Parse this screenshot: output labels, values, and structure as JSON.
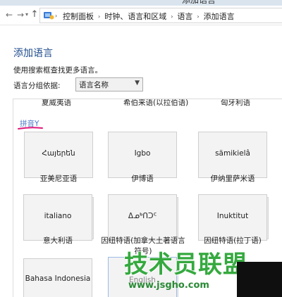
{
  "window": {
    "title": "添加语言"
  },
  "address": {
    "crumbs": [
      "控制面板",
      "时钟、语言和区域",
      "语言",
      "添加语言"
    ]
  },
  "page": {
    "title": "添加语言",
    "hint": "使用搜索框查找更多语言。",
    "group_label": "语言分组依据:",
    "group_value": "语言名称"
  },
  "previous_row": [
    "夏威夷语",
    "希伯来语(以拉伯语)",
    "匈牙利语"
  ],
  "section": {
    "header": "拼音Y"
  },
  "tiles": [
    {
      "native": "Հայերեն",
      "caption": "亚美尼亚语"
    },
    {
      "native": "Igbo",
      "caption": "伊博语"
    },
    {
      "native": "sämikielâ",
      "caption": "伊纳里萨米语"
    },
    {
      "native": "italiano",
      "caption": "意大利语"
    },
    {
      "native": "ᐃᓄᒃᑎᑐᑦ",
      "caption": "因纽特语(加拿大土著语言符号)"
    },
    {
      "native": "Inuktitut",
      "caption": "因纽特语(拉丁语)"
    },
    {
      "native": "Bahasa Indonesia",
      "caption": ""
    },
    {
      "native": "English",
      "caption": ""
    }
  ],
  "watermark": {
    "logo": "技术员联盟",
    "url": "www.jsgho.com"
  },
  "colors": {
    "accent": "#4d78c9",
    "title": "#1e4b8c",
    "watermark": "#35a93f",
    "marker": "#e0187a"
  }
}
